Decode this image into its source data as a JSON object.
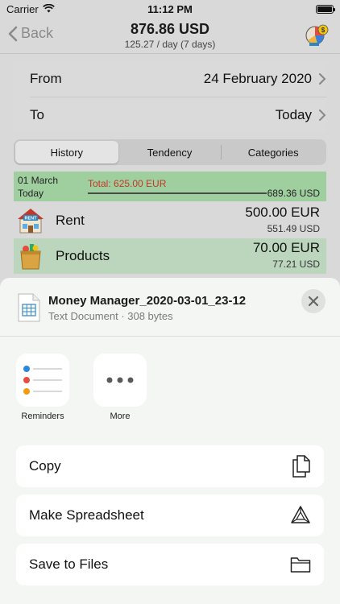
{
  "status": {
    "carrier": "Carrier",
    "time": "11:12 PM"
  },
  "nav": {
    "back_label": "Back",
    "title": "876.86 USD",
    "subtitle": "125.27 / day (7 days)"
  },
  "range": {
    "from_label": "From",
    "from_value": "24 February 2020",
    "to_label": "To",
    "to_value": "Today"
  },
  "tabs": [
    {
      "label": "History",
      "active": true
    },
    {
      "label": "Tendency",
      "active": false
    },
    {
      "label": "Categories",
      "active": false
    }
  ],
  "summary": {
    "date": "01 March",
    "today": "Today",
    "total": "Total: 625.00 EUR",
    "converted": "689.36 USD"
  },
  "items": [
    {
      "name": "Rent",
      "amount": "500.00 EUR",
      "converted": "551.49 USD",
      "icon": "house-rent-icon"
    },
    {
      "name": "Products",
      "amount": "70.00 EUR",
      "converted": "77.21 USD",
      "icon": "grocery-bag-icon"
    }
  ],
  "share": {
    "file_name": "Money Manager_2020-03-01_23-12",
    "file_meta": "Text Document · 308 bytes",
    "apps": [
      {
        "label": "Reminders",
        "icon": "reminders-icon"
      },
      {
        "label": "More",
        "icon": "more-icon"
      }
    ],
    "actions": [
      {
        "label": "Copy",
        "icon": "copy-icon"
      },
      {
        "label": "Make Spreadsheet",
        "icon": "spreadsheet-icon"
      },
      {
        "label": "Save to Files",
        "icon": "folder-icon"
      }
    ]
  },
  "colors": {
    "summary_bg": "#9fcf9f",
    "total_red": "#c0392b",
    "selected_row": "#bcd6bd"
  }
}
